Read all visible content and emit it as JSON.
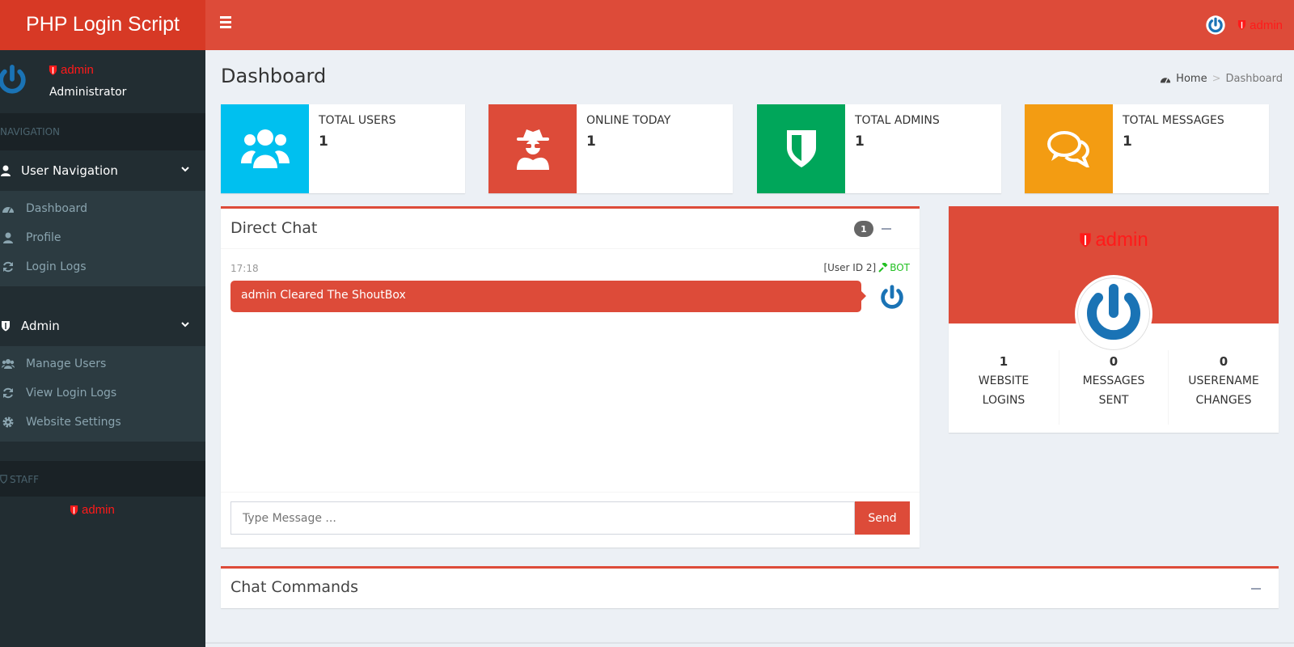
{
  "app": {
    "title": "PHP Login Script"
  },
  "header": {
    "menu_icon": "bars-icon",
    "user_label": "admin"
  },
  "sidebar": {
    "user": {
      "name": "admin",
      "role": "Administrator"
    },
    "nav_header": "NAVIGATION",
    "groups": [
      {
        "label": "User Navigation",
        "icon": "user-icon",
        "items": [
          {
            "label": "Dashboard",
            "icon": "dashboard-icon"
          },
          {
            "label": "Profile",
            "icon": "user-icon"
          },
          {
            "label": "Login Logs",
            "icon": "refresh-icon"
          }
        ]
      },
      {
        "label": "Admin",
        "icon": "shield-icon",
        "items": [
          {
            "label": "Manage Users",
            "icon": "users-icon"
          },
          {
            "label": "View Login Logs",
            "icon": "refresh-icon"
          },
          {
            "label": "Website Settings",
            "icon": "gear-icon"
          }
        ]
      }
    ],
    "staff_header": "STAFF",
    "staff": [
      {
        "name": "admin"
      }
    ]
  },
  "page": {
    "title": "Dashboard",
    "breadcrumb": {
      "home": "Home",
      "separator": ">",
      "current": "Dashboard"
    }
  },
  "info_boxes": [
    {
      "label": "TOTAL USERS",
      "value": "1",
      "color": "#00c0ef",
      "icon": "users-icon"
    },
    {
      "label": "ONLINE TODAY",
      "value": "1",
      "color": "#dd4b39",
      "icon": "spy-icon"
    },
    {
      "label": "TOTAL ADMINS",
      "value": "1",
      "color": "#00a65a",
      "icon": "shield-icon"
    },
    {
      "label": "TOTAL MESSAGES",
      "value": "1",
      "color": "#f39c12",
      "icon": "comments-icon"
    }
  ],
  "chat": {
    "title": "Direct Chat",
    "badge": "1",
    "messages": [
      {
        "time": "17:18",
        "user": "[User ID 2]",
        "tag": "BOT",
        "text": "admin Cleared The ShoutBox"
      }
    ],
    "input_placeholder": "Type Message ...",
    "send_label": "Send"
  },
  "profile": {
    "name": "admin",
    "stats": [
      {
        "value": "1",
        "line1": "WEBSITE",
        "line2": "LOGINS"
      },
      {
        "value": "0",
        "line1": "MESSAGES",
        "line2": "SENT"
      },
      {
        "value": "0",
        "line1": "USERENAME",
        "line2": "CHANGES"
      }
    ]
  },
  "commands": {
    "title": "Chat Commands"
  },
  "colors": {
    "primary": "#dd4b39",
    "logo_bg": "#d73925",
    "sidebar_bg": "#222d32",
    "avatar_blue": "#1a73b5",
    "bot_green": "#22c022"
  }
}
